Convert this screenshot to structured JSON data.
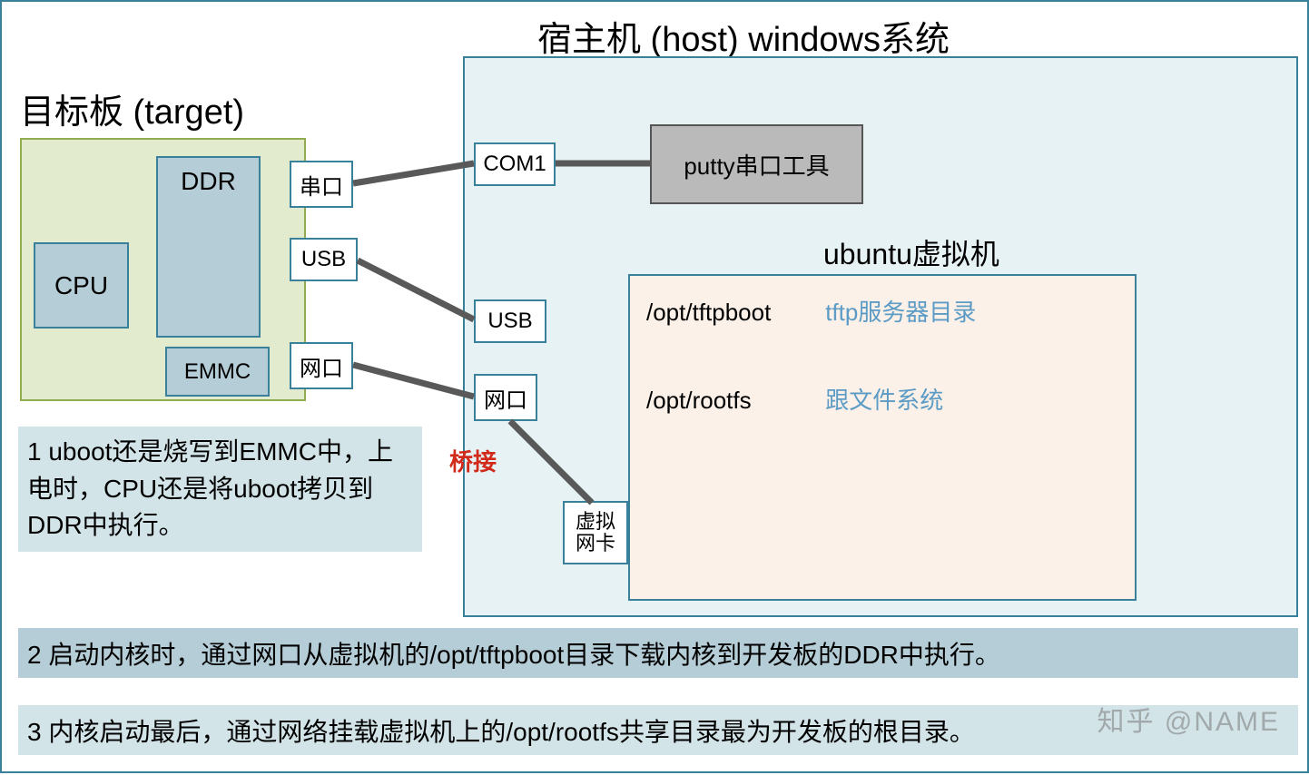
{
  "titles": {
    "target": "目标板 (target)",
    "host": "宿主机 (host) windows系统",
    "vm": "ubuntu虚拟机"
  },
  "target_board": {
    "cpu": "CPU",
    "ddr": "DDR",
    "emmc": "EMMC",
    "ports": {
      "serial": "串口",
      "usb": "USB",
      "net": "网口"
    }
  },
  "host": {
    "com1": "COM1",
    "usb": "USB",
    "net": "网口",
    "putty": "putty串口工具",
    "bridge": "桥接",
    "virt_nic_1": "虚拟",
    "virt_nic_2": "网卡"
  },
  "vm": {
    "row1_path": "/opt/tftpboot",
    "row1_desc": "tftp服务器目录",
    "row2_path": "/opt/rootfs",
    "row2_desc": "跟文件系统"
  },
  "notes": {
    "n1": "1 uboot还是烧写到EMMC中，上电时，CPU还是将uboot拷贝到DDR中执行。",
    "n2": "2 启动内核时，通过网口从虚拟机的/opt/tftpboot目录下载内核到开发板的DDR中执行。",
    "n3": "3 内核启动最后，通过网络挂载虚拟机上的/opt/rootfs共享目录最为开发板的根目录。"
  },
  "watermark": "知乎 @NAME"
}
